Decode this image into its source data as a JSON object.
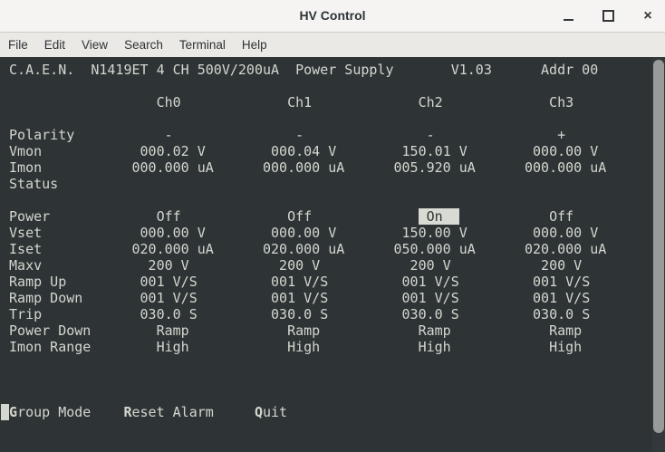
{
  "window": {
    "title": "HV Control",
    "controls": [
      "minimize",
      "maximize",
      "close"
    ]
  },
  "menu": {
    "items": [
      "File",
      "Edit",
      "View",
      "Search",
      "Terminal",
      "Help"
    ]
  },
  "terminal": {
    "header_line": "C.A.E.N.  N1419ET 4 CH 500V/200uA  Power Supply       V1.03      Addr 00",
    "channels": [
      "Ch0",
      "Ch1",
      "Ch2",
      "Ch3"
    ],
    "rows": [
      {
        "label": "Polarity",
        "values": [
          "-",
          "-",
          "-",
          "+"
        ]
      },
      {
        "label": "Vmon",
        "values": [
          "000.02 V",
          "000.04 V",
          "150.01 V",
          "000.00 V"
        ]
      },
      {
        "label": "Imon",
        "values": [
          "000.000 uA",
          "000.000 uA",
          "005.920 uA",
          "000.000 uA"
        ]
      },
      {
        "label": "Status",
        "values": [
          "",
          "",
          "",
          ""
        ]
      },
      {
        "label": "Power",
        "values": [
          "Off",
          "Off",
          "On",
          "Off"
        ],
        "highlight_index": 2
      },
      {
        "label": "Vset",
        "values": [
          "000.00 V",
          "000.00 V",
          "150.00 V",
          "000.00 V"
        ]
      },
      {
        "label": "Iset",
        "values": [
          "020.000 uA",
          "020.000 uA",
          "050.000 uA",
          "020.000 uA"
        ]
      },
      {
        "label": "Maxv",
        "values": [
          "200 V",
          "200 V",
          "200 V",
          "200 V"
        ]
      },
      {
        "label": "Ramp Up",
        "values": [
          "001 V/S",
          "001 V/S",
          "001 V/S",
          "001 V/S"
        ]
      },
      {
        "label": "Ramp Down",
        "values": [
          "001 V/S",
          "001 V/S",
          "001 V/S",
          "001 V/S"
        ]
      },
      {
        "label": "Trip",
        "values": [
          "030.0 S",
          "030.0 S",
          "030.0 S",
          "030.0 S"
        ]
      },
      {
        "label": "Power Down",
        "values": [
          "Ramp",
          "Ramp",
          "Ramp",
          "Ramp"
        ]
      },
      {
        "label": "Imon Range",
        "values": [
          "High",
          "High",
          "High",
          "High"
        ]
      }
    ],
    "actions": [
      {
        "hotkey": "G",
        "label": "Group Mode"
      },
      {
        "hotkey": "R",
        "label": "Reset Alarm"
      },
      {
        "hotkey": "Q",
        "label": "Quit"
      }
    ],
    "colors": {
      "background": "#2E3436",
      "foreground": "#D3D7CF",
      "highlight_bg": "#D8DBD3",
      "highlight_fg": "#2E3436"
    }
  }
}
